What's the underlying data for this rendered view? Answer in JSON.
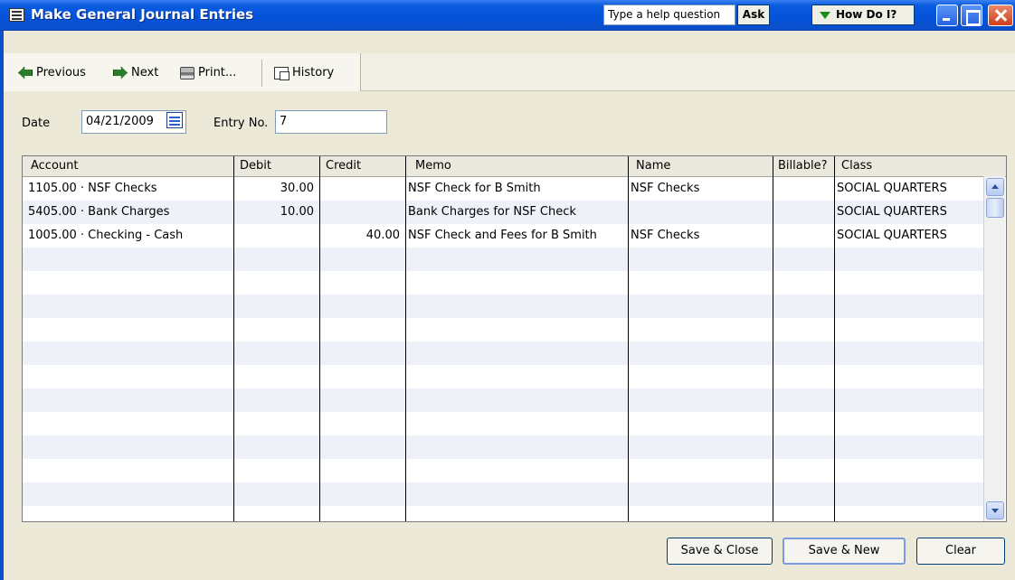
{
  "window": {
    "title": "Make General Journal Entries",
    "help_placeholder": "Type a help question",
    "ask_label": "Ask",
    "how_do_i_label": "How Do I?"
  },
  "toolbar": {
    "previous_label": "Previous",
    "next_label": "Next",
    "print_label": "Print...",
    "history_label": "History"
  },
  "form": {
    "date_label": "Date",
    "date_value": "04/21/2009",
    "entry_no_label": "Entry No.",
    "entry_no_value": "7"
  },
  "grid": {
    "columns": [
      "Account",
      "Debit",
      "Credit",
      "Memo",
      "Name",
      "Billable?",
      "Class"
    ],
    "rows": [
      {
        "account": "1105.00 · NSF Checks",
        "debit": "30.00",
        "credit": "",
        "memo": "NSF Check for B Smith",
        "name": "NSF Checks",
        "billable": "",
        "class": "SOCIAL QUARTERS"
      },
      {
        "account": "5405.00 · Bank Charges",
        "debit": "10.00",
        "credit": "",
        "memo": "Bank Charges for NSF Check",
        "name": "",
        "billable": "",
        "class": "SOCIAL QUARTERS"
      },
      {
        "account": "1005.00 · Checking - Cash",
        "debit": "",
        "credit": "40.00",
        "memo": "NSF Check and Fees for B Smith",
        "name": "NSF Checks",
        "billable": "",
        "class": "SOCIAL QUARTERS"
      }
    ]
  },
  "buttons": {
    "save_close_label": "Save & Close",
    "save_new_label": "Save & New",
    "clear_label": "Clear"
  }
}
